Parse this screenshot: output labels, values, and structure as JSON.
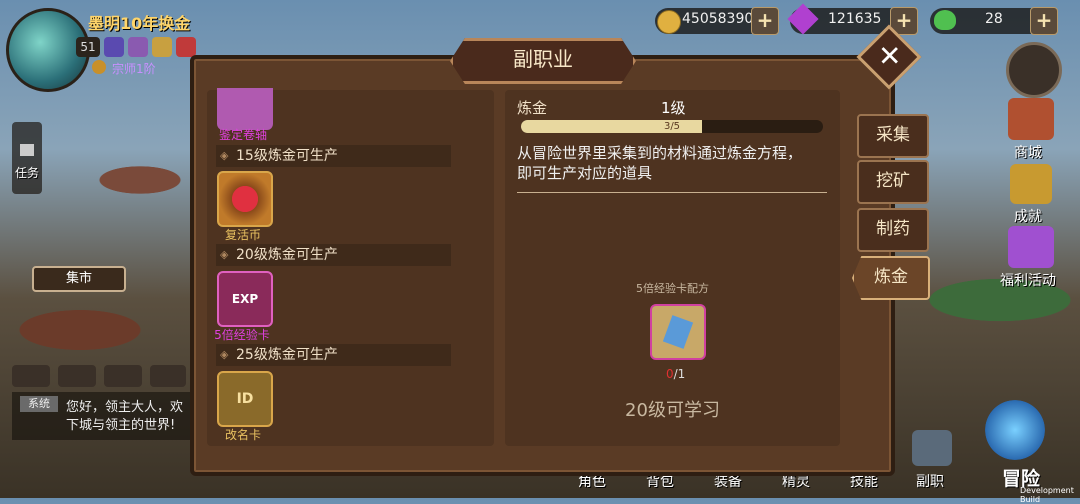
{
  "player": {
    "name": "墨明10年换金",
    "level": "51",
    "rank": "宗师1阶"
  },
  "resources": [
    {
      "icon": "gold-coin-icon",
      "value": "45058390"
    },
    {
      "icon": "purple-gem-icon",
      "value": "121635"
    },
    {
      "icon": "green-heart-icon",
      "value": "28"
    }
  ],
  "left_sidebar": {
    "task_label": "任务",
    "market_label": "集市"
  },
  "chat": {
    "channel": "系统",
    "line1": "您好，领主大人，欢",
    "line2": "下城与领主的世界!"
  },
  "panel": {
    "title": "副职业",
    "close": "✕",
    "sections": [
      {
        "label": "15级炼金可生产"
      },
      {
        "label": "20级炼金可生产"
      },
      {
        "label": "25级炼金可生产"
      }
    ],
    "items": [
      {
        "name": "鉴定卷轴",
        "color": "#e040e0"
      },
      {
        "name": "复活币",
        "color": "#e8c060"
      },
      {
        "name": "5倍经验卡",
        "color": "#e040e0"
      },
      {
        "name": "改名卡",
        "color": "#e8c060"
      }
    ],
    "detail": {
      "skill_name": "炼金",
      "skill_level": "1级",
      "progress_text": "3/5",
      "progress": 0.6,
      "description_line1": "从冒险世界里采集到的材料通过炼金方程，",
      "description_line2": "即可生产对应的道具",
      "recipe_title": "5倍经验卡配方",
      "recipe_count_have": "0",
      "recipe_count_need": "/1",
      "learn_hint": "20级可学习"
    },
    "tabs": [
      {
        "label": "采集",
        "active": false
      },
      {
        "label": "挖矿",
        "active": false
      },
      {
        "label": "制药",
        "active": false
      },
      {
        "label": "炼金",
        "active": true
      }
    ]
  },
  "right_menu": [
    {
      "label": "商城"
    },
    {
      "label": "成就"
    },
    {
      "label": "福利活动"
    }
  ],
  "bottom_menu": [
    {
      "label": "角色"
    },
    {
      "label": "背包"
    },
    {
      "label": "装备"
    },
    {
      "label": "精灵"
    },
    {
      "label": "技能"
    },
    {
      "label": "副职"
    },
    {
      "label": "冒险"
    }
  ],
  "build_label": "Development Build"
}
